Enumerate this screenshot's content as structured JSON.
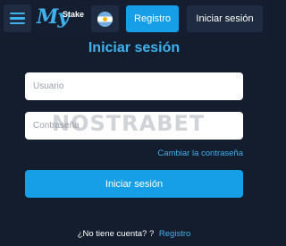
{
  "header": {
    "logo_text": "My",
    "logo_sub": "Stake",
    "flag_icon": "argentina-flag-icon",
    "register_label": "Registro",
    "login_label": "Iniciar sesión"
  },
  "form": {
    "title": "Iniciar sesión",
    "username_placeholder": "Usuario",
    "password_placeholder": "Contraseña",
    "forgot_label": "Cambiar la contraseña",
    "submit_label": "Iniciar sesión",
    "signup_prompt": "¿No tiene cuenta? ?",
    "signup_link": "Registro"
  },
  "watermark": "NOSTRABET",
  "colors": {
    "background": "#131d2e",
    "accent": "#169fe6",
    "link": "#3fb2ee"
  }
}
